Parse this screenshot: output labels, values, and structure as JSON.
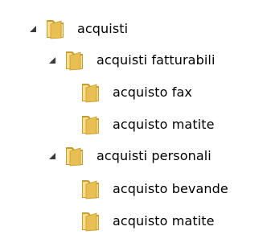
{
  "tree": {
    "root": {
      "label": "acquisti",
      "expanded": true,
      "children": [
        {
          "label": "acquisti fatturabili",
          "expanded": true,
          "children": [
            {
              "label": "acquisto fax"
            },
            {
              "label": "acquisto matite"
            }
          ]
        },
        {
          "label": "acquisti personali",
          "expanded": true,
          "children": [
            {
              "label": "acquisto bevande"
            },
            {
              "label": "acquisto matite"
            }
          ]
        }
      ]
    }
  },
  "icons": {
    "expander": "expanded-triangle-icon",
    "folder": "folder-icon"
  },
  "colors": {
    "expander": "#3b3b3b",
    "folder_light": "#f6df8e",
    "folder_mid": "#e8bf52",
    "folder_dark": "#c99a2c",
    "text": "#000000",
    "background": "#ffffff"
  }
}
